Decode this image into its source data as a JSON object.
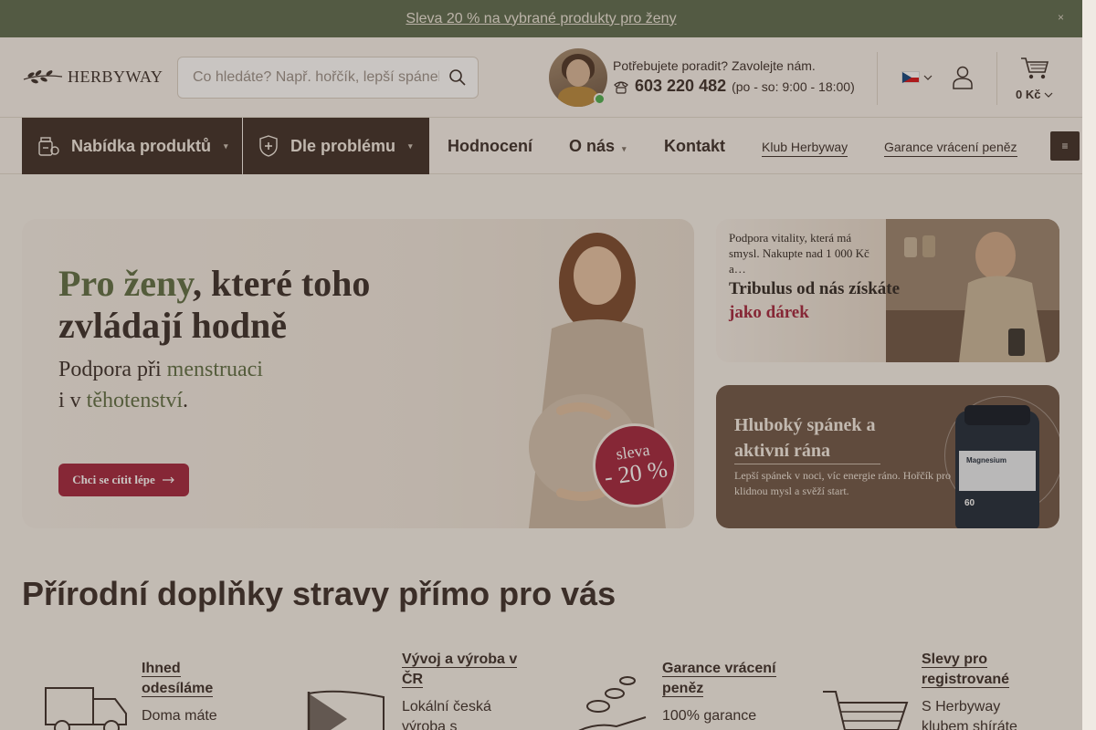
{
  "promo_bar": {
    "text": "Sleva 20 % na vybrané produkty pro ženy",
    "close": "×"
  },
  "header": {
    "logo": "HERBYWAY",
    "search_placeholder": "Co hledáte? Např. hořčík, lepší spánek",
    "help_text": "Potřebujete poradit? Zavolejte nám.",
    "phone": "603 220 482",
    "hours": "(po - so: 9:00 - 18:00)",
    "cart_total": "0 Kč"
  },
  "nav": {
    "products": "Nabídka produktů",
    "problems": "Dle problému",
    "reviews": "Hodnocení",
    "about": "O nás",
    "contact": "Kontakt",
    "club": "Klub Herbyway",
    "guarantee": "Garance vrácení peněz",
    "more": "≡"
  },
  "hero": {
    "title_green": "Pro ženy",
    "title_rest": ", které toho zvládají hodně",
    "sub_1": "Podpora při ",
    "sub_green_1": "menstruaci",
    "sub_2": "i v ",
    "sub_green_2": "těhotenství",
    "sub_end": ".",
    "cta": "Chci se cítit lépe",
    "badge_1": "sleva",
    "badge_2": "- 20 %"
  },
  "promo1": {
    "small": "Podpora vitality, která má smysl. Nakupte nad 1 000 Kč a…",
    "big": "Tribulus od nás získáte ",
    "big_red": "jako dárek"
  },
  "promo2": {
    "title": "Hluboký spánek a aktivní rána",
    "desc": "Lepší spánek v noci, víc energie ráno. Hořčík pro klidnou mysl a svěží start.",
    "bottle_label": "Magnesium",
    "bottle_count": "60"
  },
  "section": {
    "title": "Přírodní doplňky stravy přímo pro vás"
  },
  "features": [
    {
      "title": "Ihned odesíláme",
      "desc": "Doma máte"
    },
    {
      "title": "Vývoj a výroba v ČR",
      "desc": "Lokální česká výroba s"
    },
    {
      "title": "Garance vrácení peněz",
      "desc": "100% garance"
    },
    {
      "title": "Slevy pro registrované",
      "desc": "S Herbyway klubem shíráte"
    }
  ],
  "colors": {
    "accent_red": "#a3253d",
    "dark_brown": "#3d2e28",
    "olive": "#5c6b4f"
  }
}
